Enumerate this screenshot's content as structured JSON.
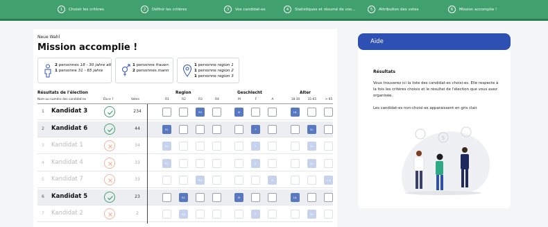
{
  "steps": [
    {
      "num": "1",
      "label": "Choisir les critères"
    },
    {
      "num": "2",
      "label": "Définir les critères"
    },
    {
      "num": "3",
      "label": "Vos candidat-es"
    },
    {
      "num": "4",
      "label": "Statistiques et résumé de vos..."
    },
    {
      "num": "5",
      "label": "Attribution des votes"
    },
    {
      "num": "6",
      "label": "Mission accomplie !"
    }
  ],
  "page": {
    "supertitle": "Neue Wahl",
    "title": "Mission accomplie !"
  },
  "summary": {
    "age": [
      {
        "count": "2",
        "text": "personnes ",
        "em": "18 - 30 jahre alt"
      },
      {
        "count": "1",
        "text": "personne ",
        "em": "31 - 65 jahre"
      }
    ],
    "gender": [
      {
        "count": "1",
        "text": "personne ",
        "em": "frauen"
      },
      {
        "count": "2",
        "text": "personnes ",
        "em": "mann"
      }
    ],
    "region": [
      {
        "count": "1",
        "text": "personne ",
        "em": "region 1"
      },
      {
        "count": "1",
        "text": "personne ",
        "em": "region 2"
      },
      {
        "count": "1",
        "text": "personne ",
        "em": "region 3"
      }
    ]
  },
  "table": {
    "results_label": "Résultats de l'élection",
    "group_region": "Region",
    "group_gender": "Geschlecht",
    "group_age": "Alter",
    "col_name": "Nom ou numéro des candidat-es",
    "col_elected": "Élu-e ?",
    "col_votes": "Votes",
    "sub_cols": [
      "R1",
      "R2",
      "R3",
      "R4",
      "M",
      "F",
      "A",
      "18-30",
      "31-65",
      "> 65"
    ],
    "rows": [
      {
        "num": "1",
        "name": "Kandidat 3",
        "elected": true,
        "votes": "234",
        "cells": [
          null,
          null,
          "R3",
          null,
          "M",
          null,
          null,
          "18-",
          null,
          null
        ]
      },
      {
        "num": "2",
        "name": "Kandidat 6",
        "elected": true,
        "votes": "44",
        "cells": [
          "R1",
          null,
          null,
          null,
          null,
          "F",
          null,
          null,
          "31-",
          null
        ]
      },
      {
        "num": "3",
        "name": "Kandidat 1",
        "elected": false,
        "votes": "34",
        "cells": [
          "R1",
          null,
          null,
          null,
          null,
          "F",
          null,
          null,
          "31-",
          null
        ]
      },
      {
        "num": "4",
        "name": "Kandidat 4",
        "elected": false,
        "votes": "33",
        "cells": [
          "R1",
          null,
          null,
          null,
          null,
          "F",
          null,
          null,
          "31-",
          null
        ]
      },
      {
        "num": "5",
        "name": "Kandidat 7",
        "elected": false,
        "votes": "33",
        "cells": [
          null,
          null,
          "R3",
          null,
          null,
          null,
          "A",
          null,
          null,
          "> 6"
        ]
      },
      {
        "num": "6",
        "name": "Kandidat 5",
        "elected": true,
        "votes": "23",
        "cells": [
          null,
          "R2",
          null,
          null,
          "M",
          null,
          null,
          "18-",
          null,
          null
        ]
      },
      {
        "num": "7",
        "name": "Kandidat 2",
        "elected": false,
        "votes": "2",
        "cells": [
          null,
          "R2",
          null,
          null,
          null,
          "F",
          null,
          null,
          "31-",
          null
        ]
      }
    ]
  },
  "help": {
    "title": "Aide",
    "heading": "Résultats",
    "p1": "Vous trouverez ici la liste des candidat-es choisi-es. Elle respecte à la fois les critères choisis et le résultat de l'élection que vous avez organisée.",
    "p2": "Les candidat-es non-choisi-es apparaissent en gris clair."
  },
  "colors": {
    "accent_green": "#40a06e",
    "accent_blue": "#2f50b3",
    "cell_on": "#5878bf"
  }
}
